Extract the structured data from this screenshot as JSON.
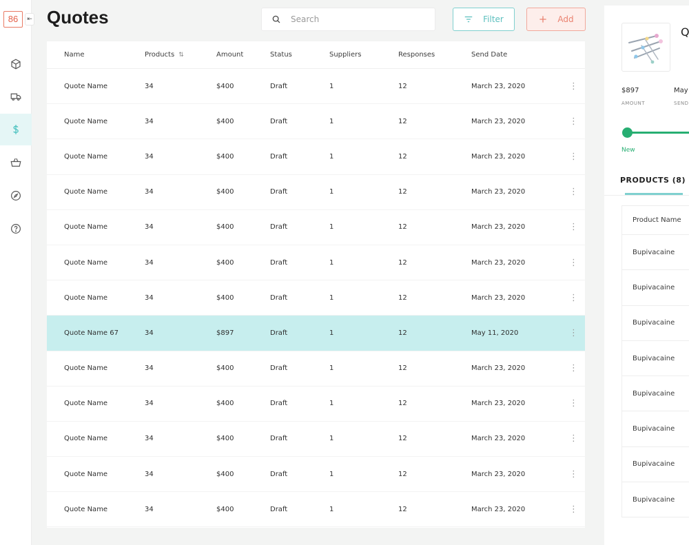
{
  "app": {
    "logo_text": "86",
    "collapse_glyph": "⇤",
    "page_title": "Quotes"
  },
  "nav": {
    "items": [
      {
        "icon": "box-icon",
        "active": false
      },
      {
        "icon": "truck-icon",
        "active": false
      },
      {
        "icon": "dollar-icon",
        "active": true
      },
      {
        "icon": "basket-icon",
        "active": false
      },
      {
        "icon": "compass-icon",
        "active": false
      },
      {
        "icon": "help-icon",
        "active": false
      }
    ],
    "accent_color": "#4fc3c1"
  },
  "toolbar": {
    "search_placeholder": "Search",
    "filter_label": "Filter",
    "add_label": "Add"
  },
  "table": {
    "columns": [
      "Name",
      "Products",
      "Amount",
      "Status",
      "Suppliers",
      "Responses",
      "Send Date"
    ],
    "selected_index": 7,
    "rows": [
      {
        "name": "Quote Name",
        "products": "34",
        "amount": "$400",
        "status": "Draft",
        "suppliers": "1",
        "responses": "12",
        "send_date": "March 23, 2020"
      },
      {
        "name": "Quote Name",
        "products": "34",
        "amount": "$400",
        "status": "Draft",
        "suppliers": "1",
        "responses": "12",
        "send_date": "March 23, 2020"
      },
      {
        "name": "Quote Name",
        "products": "34",
        "amount": "$400",
        "status": "Draft",
        "suppliers": "1",
        "responses": "12",
        "send_date": "March 23, 2020"
      },
      {
        "name": "Quote Name",
        "products": "34",
        "amount": "$400",
        "status": "Draft",
        "suppliers": "1",
        "responses": "12",
        "send_date": "March 23, 2020"
      },
      {
        "name": "Quote Name",
        "products": "34",
        "amount": "$400",
        "status": "Draft",
        "suppliers": "1",
        "responses": "12",
        "send_date": "March 23, 2020"
      },
      {
        "name": "Quote Name",
        "products": "34",
        "amount": "$400",
        "status": "Draft",
        "suppliers": "1",
        "responses": "12",
        "send_date": "March 23, 2020"
      },
      {
        "name": "Quote Name",
        "products": "34",
        "amount": "$400",
        "status": "Draft",
        "suppliers": "1",
        "responses": "12",
        "send_date": "March 23, 2020"
      },
      {
        "name": "Quote Name 67",
        "products": "34",
        "amount": "$897",
        "status": "Draft",
        "suppliers": "1",
        "responses": "12",
        "send_date": "May 11, 2020"
      },
      {
        "name": "Quote Name",
        "products": "34",
        "amount": "$400",
        "status": "Draft",
        "suppliers": "1",
        "responses": "12",
        "send_date": "March 23, 2020"
      },
      {
        "name": "Quote Name",
        "products": "34",
        "amount": "$400",
        "status": "Draft",
        "suppliers": "1",
        "responses": "12",
        "send_date": "March 23, 2020"
      },
      {
        "name": "Quote Name",
        "products": "34",
        "amount": "$400",
        "status": "Draft",
        "suppliers": "1",
        "responses": "12",
        "send_date": "March 23, 2020"
      },
      {
        "name": "Quote Name",
        "products": "34",
        "amount": "$400",
        "status": "Draft",
        "suppliers": "1",
        "responses": "12",
        "send_date": "March 23, 2020"
      },
      {
        "name": "Quote Name",
        "products": "34",
        "amount": "$400",
        "status": "Draft",
        "suppliers": "1",
        "responses": "12",
        "send_date": "March 23, 2020"
      }
    ]
  },
  "detail": {
    "title_partial": "Q",
    "amount_value": "$897",
    "amount_label": "AMOUNT",
    "send_value_partial": "May",
    "send_label_partial": "SEND",
    "stage_label": "New",
    "tab_label": "PRODUCTS (8)",
    "products_header": "Product Name",
    "products": [
      "Bupivacaine",
      "Bupivacaine",
      "Bupivacaine",
      "Bupivacaine",
      "Bupivacaine",
      "Bupivacaine",
      "Bupivacaine",
      "Bupivacaine"
    ],
    "stage_color": "#27ae72"
  }
}
